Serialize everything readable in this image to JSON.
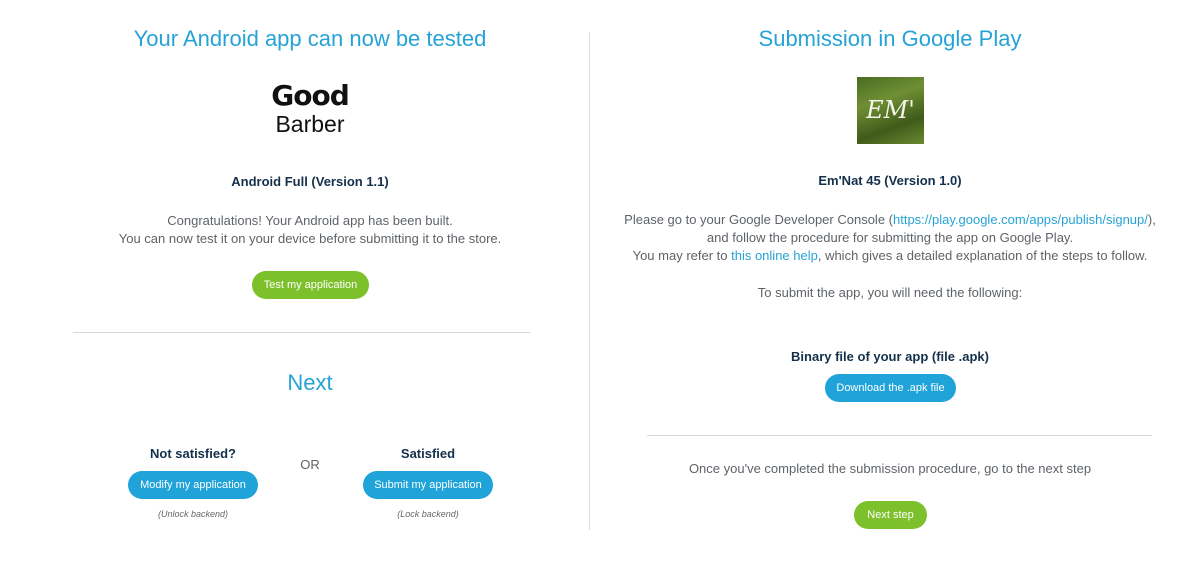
{
  "left": {
    "title": "Your Android app can now be tested",
    "logo": {
      "line1": "Good",
      "line2": "Barber"
    },
    "version_label": "Android Full (Version 1.1)",
    "message_line1": "Congratulations! Your Android app has been built.",
    "message_line2": "You can now test it on your device before submitting it to the store.",
    "test_button": "Test my application",
    "next_heading": "Next",
    "not_satisfied": {
      "label": "Not satisfied?",
      "button": "Modify my application",
      "note": "(Unlock backend)"
    },
    "or_text": "OR",
    "satisfied": {
      "label": "Satisfied",
      "button": "Submit my application",
      "note": "(Lock backend)"
    }
  },
  "right": {
    "title": "Submission in Google Play",
    "app_icon_text": "EM'",
    "version_label": "Em'Nat 45 (Version 1.0)",
    "line1_prefix": "Please go to your Google Developer Console (",
    "console_link": "https://play.google.com/apps/publish/signup/",
    "line1_suffix": "),",
    "line2": "and follow the procedure for submitting the app on Google Play.",
    "line3_prefix": "You may refer to ",
    "help_link": "this online help",
    "line3_suffix": ", which gives a detailed explanation of the steps to follow.",
    "need_text": "To submit the app, you will need the following:",
    "binary_label": "Binary file of your app (file .apk)",
    "download_button": "Download the .apk file",
    "completed_text": "Once you've completed the submission procedure, go to the next step",
    "next_button": "Next step"
  },
  "colors": {
    "accent_blue": "#1fa3d9",
    "accent_green": "#7cc02c",
    "title_blue": "#26a3d6",
    "dark_navy": "#14304a"
  }
}
